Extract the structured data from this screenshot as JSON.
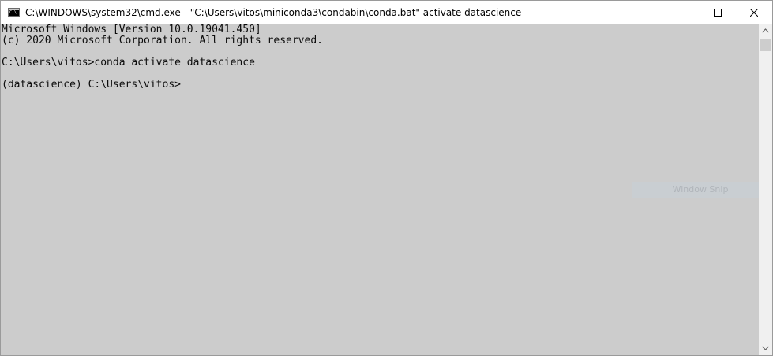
{
  "window": {
    "title": "C:\\WINDOWS\\system32\\cmd.exe - \"C:\\Users\\vitos\\miniconda3\\condabin\\conda.bat\"  activate datascience",
    "icon": "cmd-icon",
    "icon_prompt": "C:\\"
  },
  "controls": {
    "minimize": "minimize-icon",
    "maximize": "maximize-icon",
    "close": "close-icon"
  },
  "console": {
    "lines": [
      "Microsoft Windows [Version 10.0.19041.450]",
      "(c) 2020 Microsoft Corporation. All rights reserved.",
      "",
      "C:\\Users\\vitos>conda activate datascience",
      "",
      "(datascience) C:\\Users\\vitos>"
    ],
    "background": "#cccccc",
    "foreground": "#0c0c0c"
  },
  "overlay": {
    "watermark": "Window Snip"
  }
}
